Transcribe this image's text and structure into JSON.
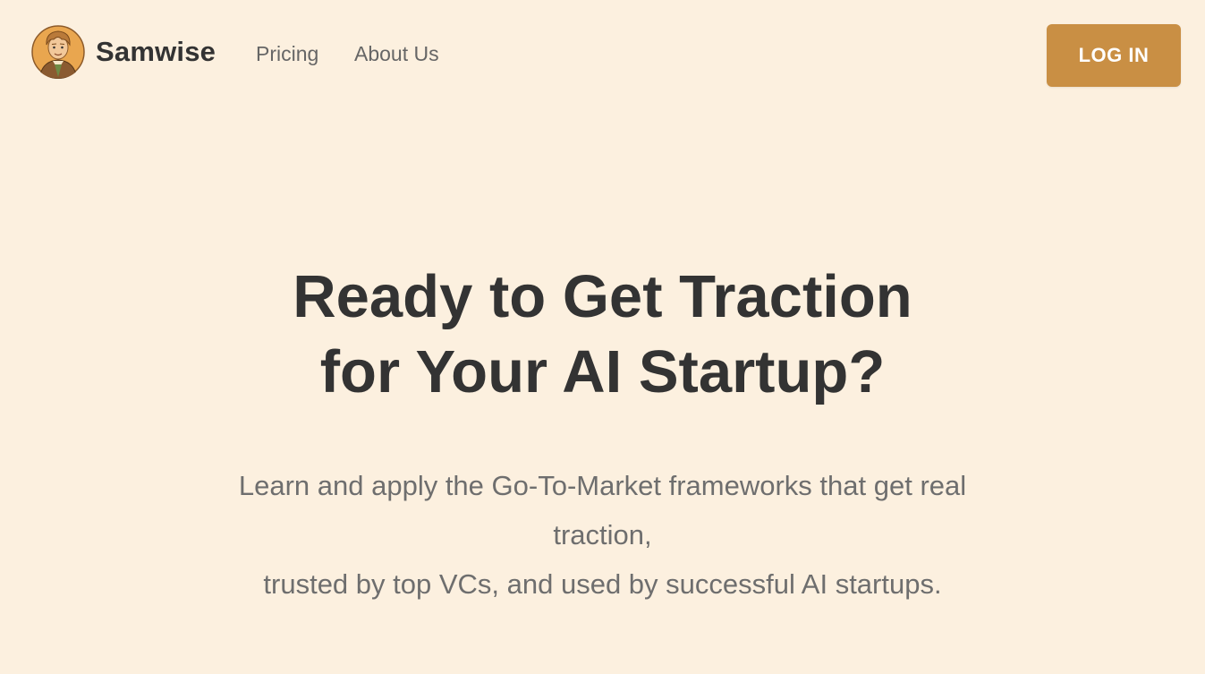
{
  "brand": {
    "name": "Samwise",
    "avatar_icon": "hobbit-avatar-icon"
  },
  "nav": {
    "links": [
      {
        "label": "Pricing"
      },
      {
        "label": "About Us"
      }
    ],
    "login_label": "LOG IN"
  },
  "hero": {
    "title_line1": "Ready to Get Traction",
    "title_line2": "for Your AI Startup?",
    "subtitle_line1": "Learn and apply the Go-To-Market frameworks that get real",
    "subtitle_line2": "traction,",
    "subtitle_line3": "trusted by top VCs, and used by successful AI startups."
  },
  "colors": {
    "background": "#fcf0df",
    "accent": "#c98f44",
    "heading": "#333333",
    "body_text": "#6e6e6e"
  }
}
